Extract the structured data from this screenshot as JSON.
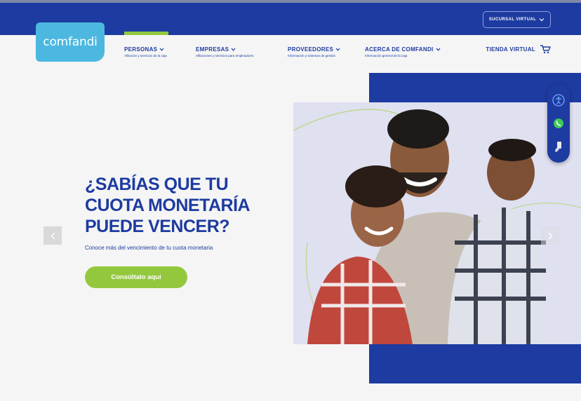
{
  "header": {
    "logo_text": "comfandi",
    "sucursal_label": "SUCURSAL VIRTUAL",
    "tienda_label": "TIENDA VIRTUAL"
  },
  "nav": {
    "items": [
      {
        "label": "PERSONAS",
        "sub": "Afiliación y servicios de la caja"
      },
      {
        "label": "EMPRESAS",
        "sub": "Afiliaciones y servicios para empleadores"
      },
      {
        "label": "PROVEEDORES",
        "sub": "Información y sistemas de gestión"
      },
      {
        "label": "ACERCA DE COMFANDI",
        "sub": "Información general de la caja"
      }
    ]
  },
  "hero": {
    "headline": "¿SABÍAS QUE TU CUOTA MONETARÍA PUEDE VENCER?",
    "subtext": "Conoce más del vencimiento de tu cuota monetaria",
    "cta_label": "Consúltalo aquí"
  },
  "side_widget": {
    "icons": [
      "accessibility-icon",
      "whatsapp-icon",
      "hand-phone-icon"
    ]
  },
  "colors": {
    "brand_blue": "#1d3ba0",
    "accent_green": "#93c83d",
    "logo_cyan": "#4cb8e0"
  }
}
